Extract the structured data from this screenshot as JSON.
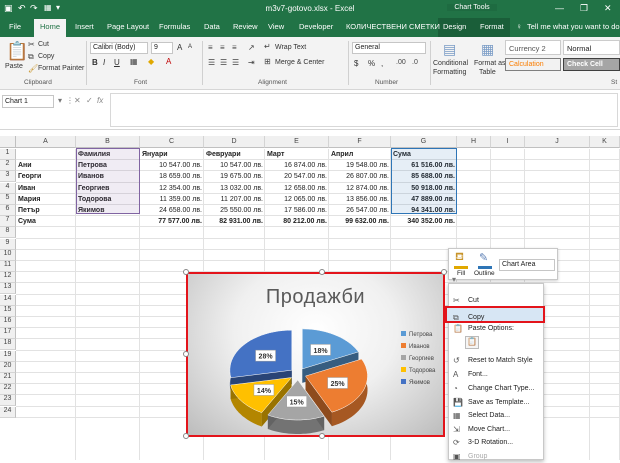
{
  "window": {
    "title": "m3v7-gotovo.xlsx - Excel",
    "context_tab_group": "Chart Tools",
    "minimize_glyph": "—",
    "restore_glyph": "❐",
    "close_glyph": "✕"
  },
  "tabs": [
    "File",
    "Home",
    "Insert",
    "Page Layout",
    "Formulas",
    "Data",
    "Review",
    "View",
    "Developer",
    "КОЛИЧЕСТВЕНИ СМЕТКИ",
    "Design",
    "Format"
  ],
  "tell_me": "Tell me what you want to do",
  "ribbon": {
    "clipboard": {
      "paste": "Paste",
      "cut": "Cut",
      "copy": "Copy",
      "format_painter": "Format Painter",
      "group": "Clipboard"
    },
    "font": {
      "name": "Calibri (Body)",
      "size": "9",
      "bold": "B",
      "italic": "I",
      "underline": "U",
      "grow": "A",
      "shrink": "A",
      "group": "Font"
    },
    "alignment": {
      "wrap_text": "Wrap Text",
      "merge_center": "Merge & Center",
      "group": "Alignment"
    },
    "number": {
      "format": "General",
      "currency": "$",
      "percent": "%",
      "comma": ",",
      "group": "Number"
    },
    "styles": {
      "conditional": "Conditional",
      "conditional2": "Formatting",
      "format_as": "Format as",
      "format_as2": "Table",
      "currency2": "Currency 2",
      "normal": "Normal",
      "calculation": "Calculation",
      "check_cell": "Check Cell",
      "group": "St"
    }
  },
  "formula_bar": {
    "name_box": "Chart 1",
    "cancel": "✕",
    "enter": "✓",
    "fx": "fx",
    "value": ""
  },
  "columns": [
    "A",
    "B",
    "C",
    "D",
    "E",
    "F",
    "G",
    "H",
    "I",
    "J",
    "K"
  ],
  "rows": [
    "1",
    "2",
    "3",
    "4",
    "5",
    "6",
    "7",
    "8",
    "9",
    "10",
    "11",
    "12",
    "13",
    "14",
    "15",
    "16",
    "17",
    "18",
    "19",
    "20",
    "21",
    "22",
    "23",
    "24"
  ],
  "table": {
    "headers": [
      "Фамилия",
      "Януари",
      "Февруари",
      "Март",
      "Април",
      "Сума"
    ],
    "rows": [
      {
        "name": "Ани",
        "surname": "Петрова",
        "jan": "10 547.00 лв.",
        "feb": "10 547.00 лв.",
        "mar": "16 874.00 лв.",
        "apr": "19 548.00 лв.",
        "sum": "61 516.00 лв."
      },
      {
        "name": "Георги",
        "surname": "Иванов",
        "jan": "18 659.00 лв.",
        "feb": "19 675.00 лв.",
        "mar": "20 547.00 лв.",
        "apr": "26 807.00 лв.",
        "sum": "85 688.00 лв."
      },
      {
        "name": "Иван",
        "surname": "Георгиев",
        "jan": "12 354.00 лв.",
        "feb": "13 032.00 лв.",
        "mar": "12 658.00 лв.",
        "apr": "12 874.00 лв.",
        "sum": "50 918.00 лв."
      },
      {
        "name": "Мария",
        "surname": "Тодорова",
        "jan": "11 359.00 лв.",
        "feb": "11 207.00 лв.",
        "mar": "12 065.00 лв.",
        "apr": "13 856.00 лв.",
        "sum": "47 889.00 лв."
      },
      {
        "name": "Петър",
        "surname": "Якимов",
        "jan": "24 658.00 лв.",
        "feb": "25 550.00 лв.",
        "mar": "17 586.00 лв.",
        "apr": "26 547.00 лв.",
        "sum": "94 341.00 лв."
      }
    ],
    "total": {
      "label": "Сума",
      "jan": "77 577.00 лв.",
      "feb": "82 931.00 лв.",
      "mar": "80 212.00 лв.",
      "apr": "99 632.00 лв.",
      "sum": "340 352.00 лв."
    }
  },
  "chart_data": {
    "type": "pie",
    "title": "Продажби",
    "categories": [
      "Петрова",
      "Иванов",
      "Георгиев",
      "Тодорова",
      "Якимов"
    ],
    "values": [
      18,
      25,
      15,
      14,
      28
    ],
    "value_labels": [
      "18%",
      "25%",
      "15%",
      "14%",
      "28%"
    ],
    "colors": [
      "#5b9bd5",
      "#ed7d31",
      "#a5a5a5",
      "#ffc000",
      "#4472c4"
    ],
    "style": "3d-exploded",
    "legend": "right"
  },
  "chart_format": {
    "fill": "Fill",
    "outline": "Outline",
    "element_select": "Chart Area"
  },
  "context_menu": {
    "items": [
      "Cut",
      "Copy",
      "Paste Options:",
      "Reset to Match Style",
      "Font...",
      "Change Chart Type...",
      "Save as Template...",
      "Select Data...",
      "Move Chart...",
      "3-D Rotation...",
      "Group"
    ],
    "selected": "Copy"
  }
}
